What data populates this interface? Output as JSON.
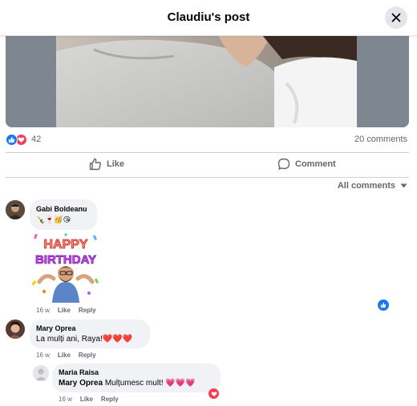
{
  "header": {
    "title": "Claudiu's post"
  },
  "post": {
    "reaction_count": "42",
    "comments_count": "20 comments",
    "like_label": "Like",
    "comment_label": "Comment"
  },
  "filter": {
    "label": "All comments"
  },
  "comments": [
    {
      "author": "Gabi Boldeanu",
      "text": "🍾🍷🥳😘",
      "sticker": {
        "line1": "HAPPY",
        "line2": "BIRTHDAY"
      },
      "time": "16 w",
      "like": "Like",
      "reply": "Reply",
      "reaction": "like-icon"
    },
    {
      "author": "Mary Oprea",
      "text": "La mulți ani, Raya!❤️❤️❤️",
      "time": "16 w",
      "like": "Like",
      "reply": "Reply"
    },
    {
      "author": "Maria Raisa",
      "mention": "Mary Oprea",
      "text": "Mulțumesc mult! 💗💗💗",
      "time": "16 w",
      "like": "Like",
      "reply": "Reply",
      "reaction": "love-icon"
    }
  ],
  "colors": {
    "accent": "#1877f2",
    "love": "#f33e58",
    "bubble": "#f0f2f5",
    "muted": "#65676b"
  }
}
